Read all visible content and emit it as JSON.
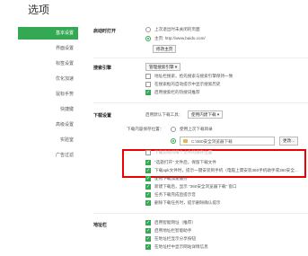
{
  "title": "选项",
  "sidebar": {
    "items": [
      {
        "label": "基本设置",
        "active": true
      },
      {
        "label": "界面设置",
        "active": false
      },
      {
        "label": "标签设置",
        "active": false
      },
      {
        "label": "优化加速",
        "active": false
      },
      {
        "label": "鼠标手势",
        "active": false
      },
      {
        "label": "快捷键",
        "active": false
      },
      {
        "label": "高级设置",
        "active": false
      },
      {
        "label": "实验室",
        "active": false
      },
      {
        "label": "广告过滤",
        "active": false
      }
    ]
  },
  "startup": {
    "heading": "启动时打开",
    "opt1": "上次退出时未关闭的页面",
    "opt2": "主页: http://www.baidu.com/",
    "modify_home": "修改主页"
  },
  "search": {
    "heading": "搜索引擎",
    "manage_button": "管理搜索引擎 ▾",
    "opt1": "地址栏搜索，抢先搜索与搜索引擎保持一致",
    "opt2": "在搜索框的自动提示中显示搜索历史",
    "opt3": "启用搜索栏的热搜词推荐"
  },
  "download": {
    "heading": "下载设置",
    "tool_label": "启用默认下载工具：",
    "tool_value": "使用内建下载 ▾",
    "save_location_label": "下载内容保存位置：",
    "opt_last_dir": "使用上次下载目录",
    "path_value": "C:\\360安全浏览器下载",
    "change_button": "更改...",
    "partial_hidden": "下载前询问每个文件的保存位置",
    "checks": [
      "\"选题打开\" 文件后，保留下载文件",
      "下载apk文件时，提示一键安装到手机（电脑上需安装360手机助手或360安全...",
      "使用下载加速服务",
      "新建下载后，显示 \"360安全浏览器下载\" 窗口",
      "任务下载完成后提示音",
      "删除下载任务时，提示删除确认提示"
    ]
  },
  "addressbar": {
    "heading": "地址栏",
    "checks": [
      "启用智能网址（推荐）",
      "启用地址栏智能助手",
      "在地址栏显示分享按钮",
      "在地址栏中显示网站详情信息"
    ]
  },
  "colors": {
    "accent": "#34a853",
    "highlight": "#e00000"
  }
}
